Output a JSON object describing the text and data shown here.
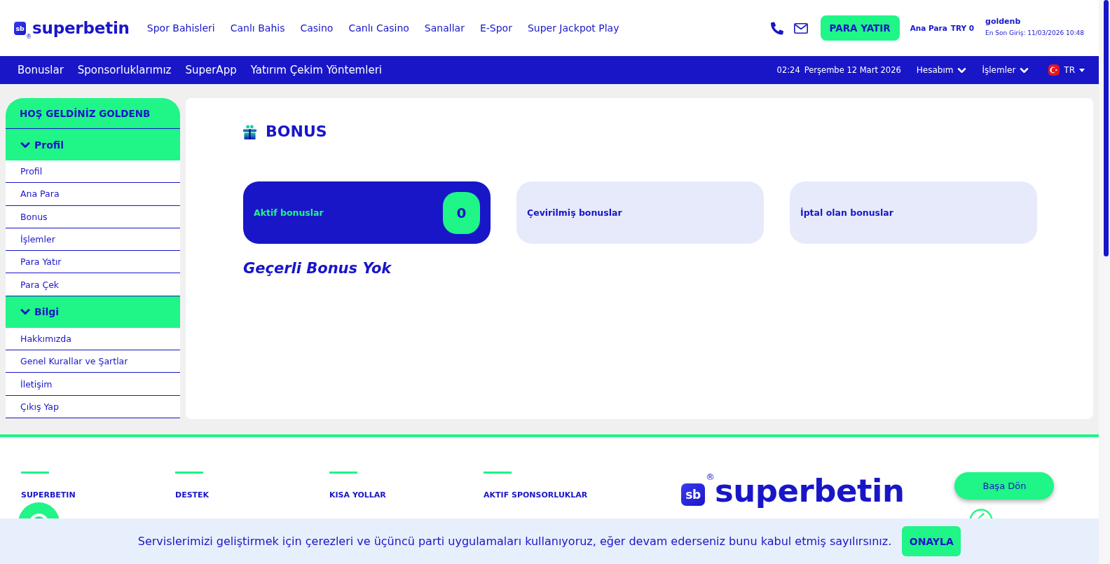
{
  "header": {
    "logo": {
      "badge": "sb",
      "mark": "®",
      "name": "superbetin"
    },
    "nav": [
      "Spor Bahisleri",
      "Canlı Bahis",
      "Casino",
      "Canlı Casino",
      "Sanallar",
      "E-Spor",
      "Super Jackpot Play"
    ],
    "deposit_button": "PARA YATIR",
    "balance": {
      "label": "Ana Para",
      "value": "TRY 0"
    },
    "user": {
      "name": "goldenb",
      "last_login": "En Son Giriş: 11/03/2026 10:48"
    }
  },
  "subnav": {
    "links": [
      "Bonuslar",
      "Sponsorluklarımız",
      "SuperApp",
      "Yatırım Çekim Yöntemleri"
    ],
    "time": "02:24",
    "date": "Perşembe 12 Mart 2026",
    "menus": [
      "Hesabım",
      "İşlemler"
    ],
    "language": "TR"
  },
  "sidebar": {
    "greeting": "HOŞ GELDİNİZ GOLDENB",
    "sections": [
      {
        "title": "Profil",
        "expanded": true,
        "items": [
          "Profil",
          "Ana Para",
          "Bonus",
          "İşlemler",
          "Para Yatır",
          "Para Çek"
        ]
      },
      {
        "title": "Bilgi",
        "expanded": true,
        "items": [
          "Hakkımızda",
          "Genel Kurallar ve Şartlar",
          "İletişim",
          "Çıkış Yap"
        ]
      }
    ]
  },
  "content": {
    "title": "BONUS",
    "tabs": [
      {
        "label": "Aktif bonuslar",
        "selected": true,
        "count": "0"
      },
      {
        "label": "Çevirilmiş bonuslar",
        "selected": false
      },
      {
        "label": "İptal olan bonuslar",
        "selected": false
      }
    ],
    "empty_message": "Geçerli Bonus Yok"
  },
  "footer": {
    "columns": [
      "SUPERBETIN",
      "DESTEK",
      "KISA YOLLAR",
      "AKTIF SPONSORLUKLAR"
    ],
    "logo": {
      "badge": "sb",
      "mark": "®",
      "name": "superbetin"
    },
    "back_to_top": "Başa Dön"
  },
  "cookie_banner": {
    "text": "Servislerimizi geliştirmek için çerezleri ve üçüncü parti uygulamaları kullanıyoruz, eğer devam ederseniz bunu kabul etmiş sayılırsınız.",
    "button": "ONAYLA"
  }
}
